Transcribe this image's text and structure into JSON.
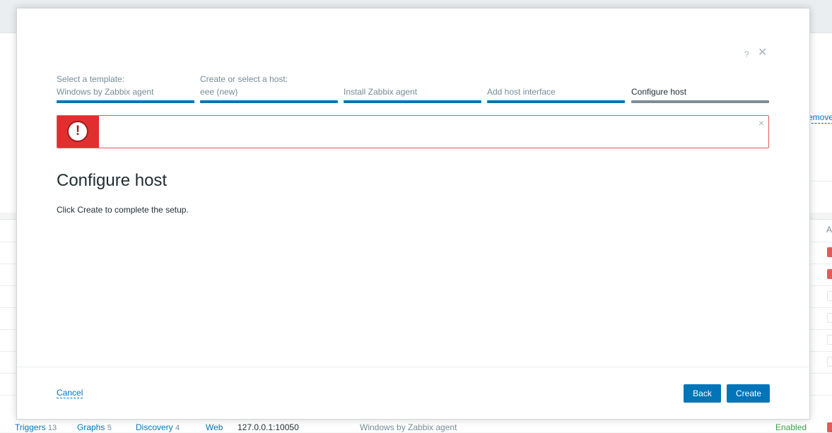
{
  "modal": {
    "help_symbol": "?",
    "close_symbol": "✕",
    "steps": [
      {
        "line1": "Select a template:",
        "line2": "Windows by Zabbix agent",
        "state": "done"
      },
      {
        "line1": "Create or select a host:",
        "line2": "eee (new)",
        "state": "done"
      },
      {
        "line1": "",
        "line2": "Install Zabbix agent",
        "state": "done"
      },
      {
        "line1": "",
        "line2": "Add host interface",
        "state": "done"
      },
      {
        "line1": "",
        "line2": "Configure host",
        "state": "current"
      }
    ],
    "alert": {
      "icon_symbol": "!",
      "message": "",
      "close_symbol": "×"
    },
    "title": "Configure host",
    "description": "Click Create to complete the setup.",
    "footer": {
      "cancel_label": "Cancel",
      "back_label": "Back",
      "create_label": "Create"
    }
  },
  "background": {
    "remove_link": "emove",
    "column_head": "A",
    "bottom_row": {
      "triggers_label": "Triggers",
      "triggers_count": "13",
      "graphs_label": "Graphs",
      "graphs_count": "5",
      "discovery_label": "Discovery",
      "discovery_count": "4",
      "web_label": "Web",
      "interface": "127.0.0.1:10050",
      "template": "Windows by Zabbix agent",
      "status": "Enabled"
    }
  },
  "colors": {
    "accent": "#0275b8",
    "error": "#e45959",
    "error_strong": "#e12f2f",
    "current_step": "#7f8c94",
    "enabled": "#429e47"
  }
}
